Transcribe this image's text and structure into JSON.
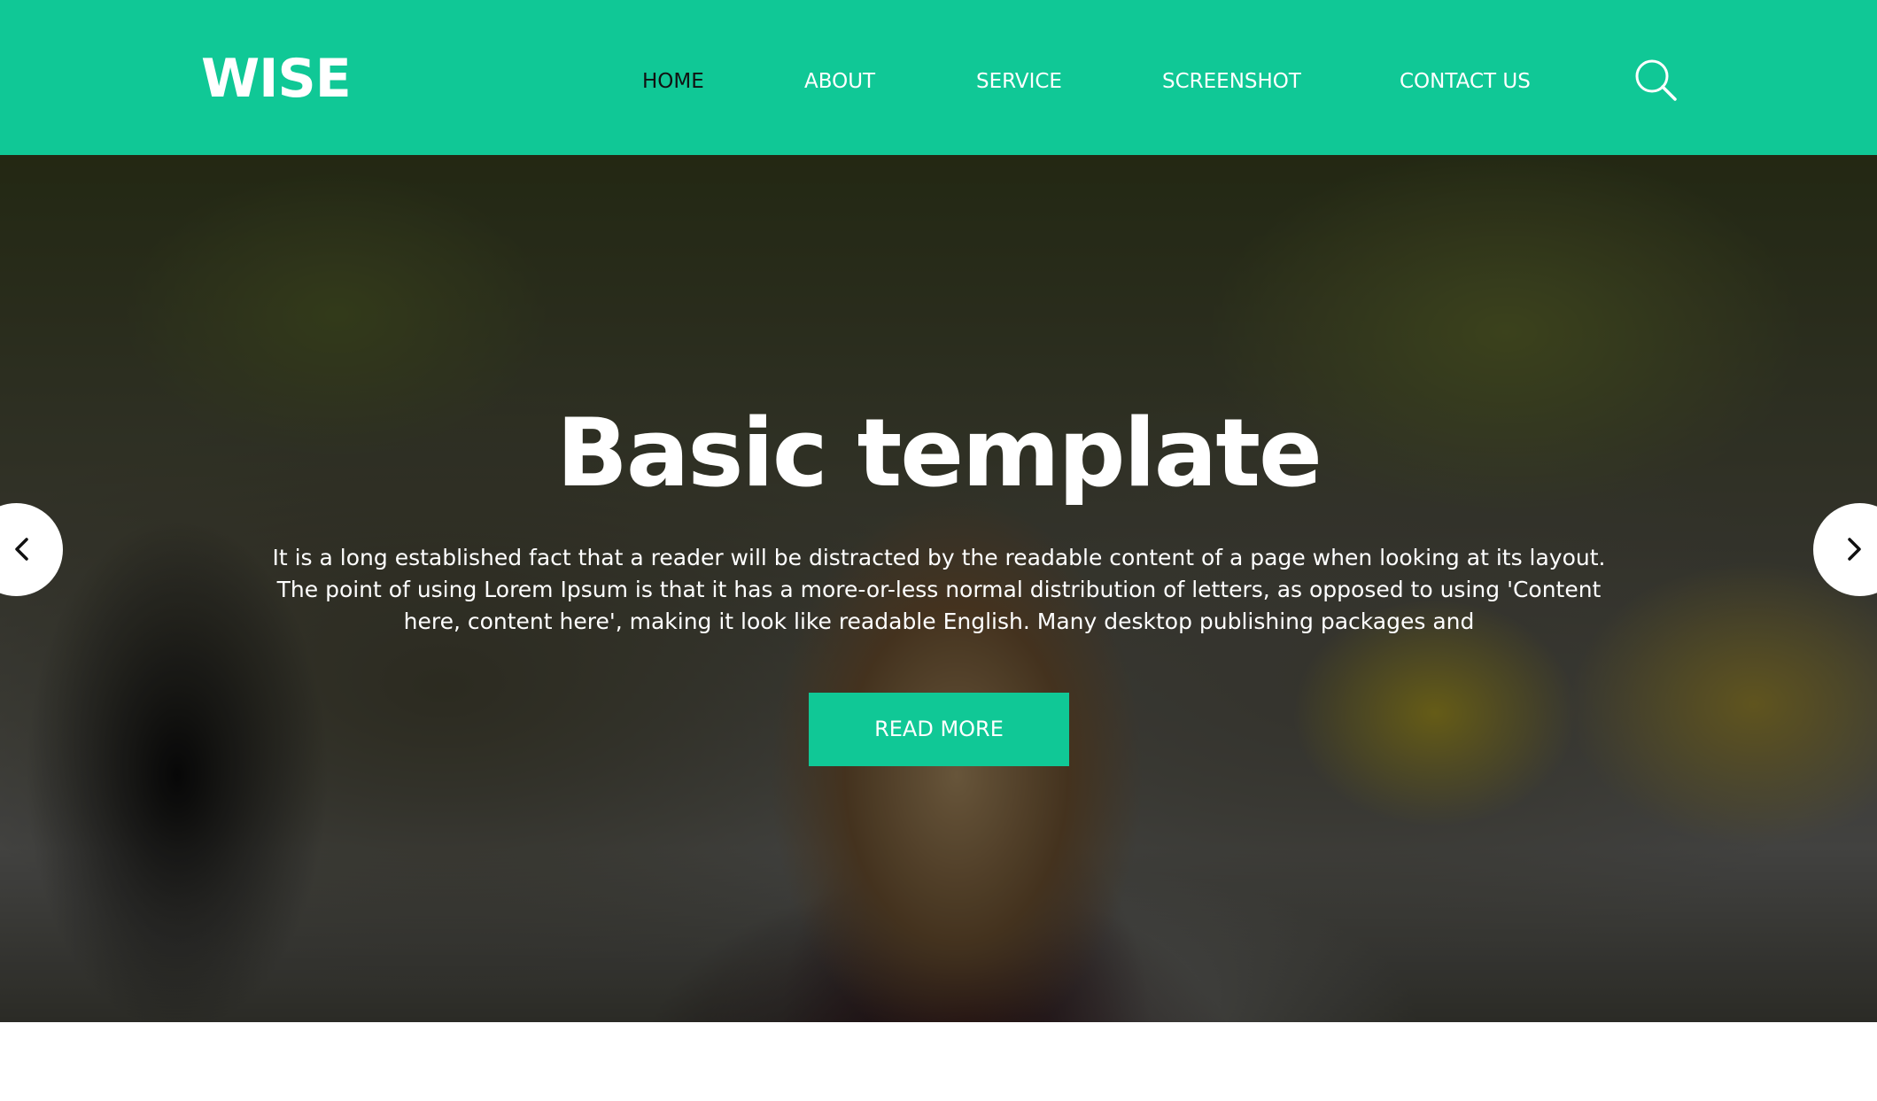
{
  "header": {
    "logo": "WISE",
    "nav": [
      {
        "label": "HOME",
        "active": true
      },
      {
        "label": "ABOUT",
        "active": false
      },
      {
        "label": "SERVICE",
        "active": false
      },
      {
        "label": "SCREENSHOT",
        "active": false
      },
      {
        "label": "CONTACT US",
        "active": false
      }
    ],
    "search_icon": "search-icon"
  },
  "hero": {
    "title": "Basic template",
    "description": "It is a long established fact that a reader will be distracted by the readable content of a page when looking at its layout. The point of using Lorem Ipsum is that it has a more-or-less normal distribution of letters, as opposed to using 'Content here, content here', making it look like readable English. Many desktop publishing packages and",
    "cta_label": "READ MORE",
    "prev_icon": "chevron-left-icon",
    "next_icon": "chevron-right-icon"
  },
  "colors": {
    "accent": "#10c896",
    "active_nav": "#111111",
    "text_light": "#ffffff"
  }
}
